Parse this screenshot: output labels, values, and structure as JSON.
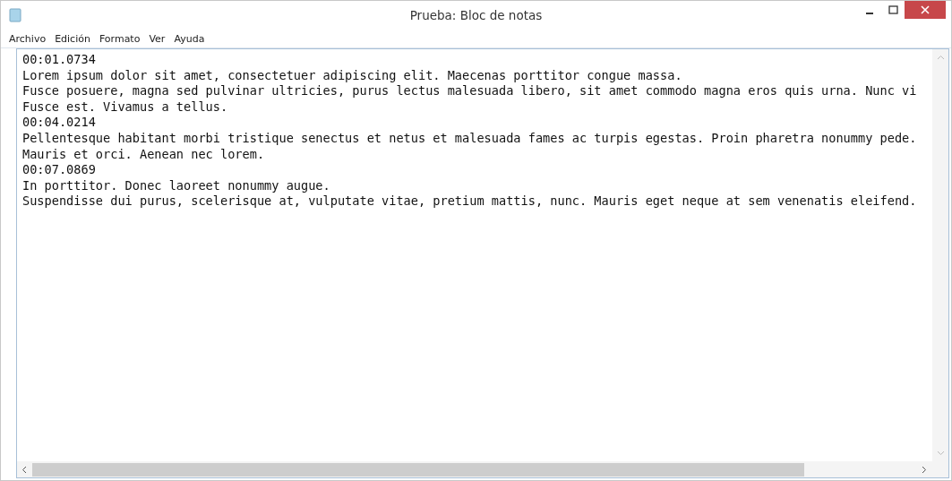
{
  "window": {
    "title": "Prueba: Bloc de notas"
  },
  "menu": [
    "Archivo",
    "Edición",
    "Formato",
    "Ver",
    "Ayuda"
  ],
  "lines": [
    "00:01.0734",
    "Lorem ipsum dolor sit amet, consectetuer adipiscing elit. Maecenas porttitor congue massa.",
    "Fusce posuere, magna sed pulvinar ultricies, purus lectus malesuada libero, sit amet commodo magna eros quis urna. Nunc vi",
    "Fusce est. Vivamus a tellus.",
    "00:04.0214",
    "Pellentesque habitant morbi tristique senectus et netus et malesuada fames ac turpis egestas. Proin pharetra nonummy pede.",
    "Mauris et orci. Aenean nec lorem.",
    "00:07.0869",
    "In porttitor. Donec laoreet nonummy augue.",
    "Suspendisse dui purus, scelerisque at, vulputate vitae, pretium mattis, nunc. Mauris eget neque at sem venenatis eleifend."
  ]
}
